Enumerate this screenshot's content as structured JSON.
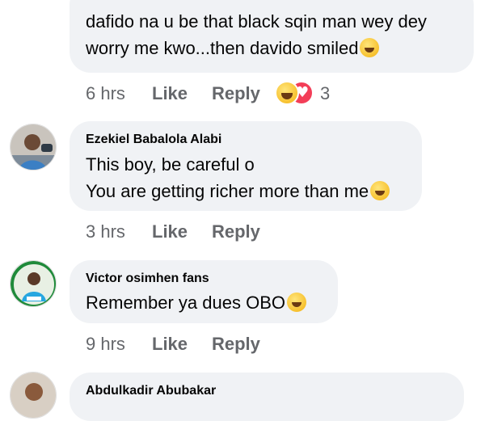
{
  "comments": [
    {
      "author": "",
      "lines": [
        "dafido na u be that black sqin man wey dey",
        "worry me kwo...then davido smiled"
      ],
      "time": "6 hrs",
      "like_label": "Like",
      "reply_label": "Reply",
      "reaction_count": "3"
    },
    {
      "author": "Ezekiel Babalola Alabi",
      "lines": [
        "This boy, be careful o",
        "You are getting richer more than me"
      ],
      "time": "3 hrs",
      "like_label": "Like",
      "reply_label": "Reply"
    },
    {
      "author": "Victor osimhen fans",
      "lines": [
        "Remember ya dues OBO"
      ],
      "time": "9 hrs",
      "like_label": "Like",
      "reply_label": "Reply"
    },
    {
      "author": "Abdulkadir Abubakar",
      "lines": []
    }
  ],
  "colors": {
    "bubble": "#f0f2f5",
    "meta": "#65676b",
    "text": "#050505",
    "love": "#f33e58"
  },
  "icons": {
    "emoji_smile": "smiling-face-emoji",
    "emoji_laugh": "rolling-laughing-emoji",
    "emoji_tears": "tears-of-joy-emoji"
  }
}
